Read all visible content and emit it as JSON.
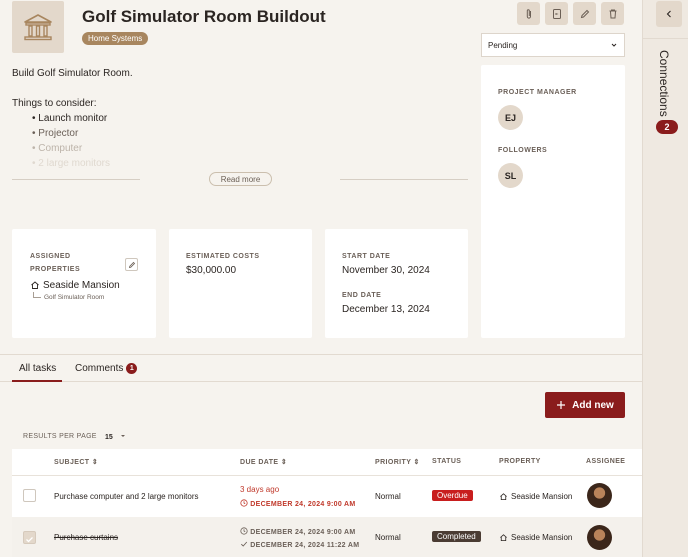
{
  "header": {
    "title": "Golf Simulator Room Buildout",
    "tag": "Home Systems",
    "status": "Pending"
  },
  "description": {
    "intro": "Build Golf Simulator Room.",
    "consider": "Things to consider:",
    "items": [
      "Launch monitor",
      "Projector",
      "Computer",
      "2 large monitors"
    ],
    "read_more": "Read more"
  },
  "people": {
    "pm_label": "PROJECT MANAGER",
    "pm_initials": "EJ",
    "followers_label": "FOLLOWERS",
    "follower_initials": "SL"
  },
  "cards": {
    "assigned_label_1": "ASSIGNED",
    "assigned_label_2": "PROPERTIES",
    "property": "Seaside Mansion",
    "room": "Golf Simulator Room",
    "costs_label": "ESTIMATED COSTS",
    "costs": "$30,000.00",
    "start_label": "START DATE",
    "start": "November 30, 2024",
    "end_label": "END DATE",
    "end": "December 13, 2024"
  },
  "tabs": {
    "all_tasks": "All tasks",
    "comments": "Comments",
    "comments_count": "1"
  },
  "right_pane": {
    "connections": "Connections",
    "connections_count": "2"
  },
  "toolbar": {
    "add_new": "Add new",
    "rpp_label": "RESULTS PER PAGE",
    "rpp_value": "15"
  },
  "table": {
    "headers": {
      "subject": "SUBJECT",
      "due_date": "DUE DATE",
      "priority": "PRIORITY",
      "status": "STATUS",
      "property": "PROPERTY",
      "assignee": "ASSIGNEE"
    },
    "rows": [
      {
        "subject": "Purchase computer and 2 large monitors",
        "due_relative": "3 days ago",
        "due_date": "DECEMBER 24, 2024 9:00 AM",
        "priority": "Normal",
        "status": "Overdue",
        "property": "Seaside Mansion"
      },
      {
        "subject": "Purchase curtains",
        "due_date": "DECEMBER 24, 2024 9:00 AM",
        "completed_date": "DECEMBER 24, 2024 11:22 AM",
        "priority": "Normal",
        "status": "Completed",
        "property": "Seaside Mansion"
      }
    ]
  },
  "colors": {
    "accent": "#8a1c1c",
    "tag": "#a8865f",
    "tan": "#e3d8cb",
    "background": "#f6f3ee"
  }
}
